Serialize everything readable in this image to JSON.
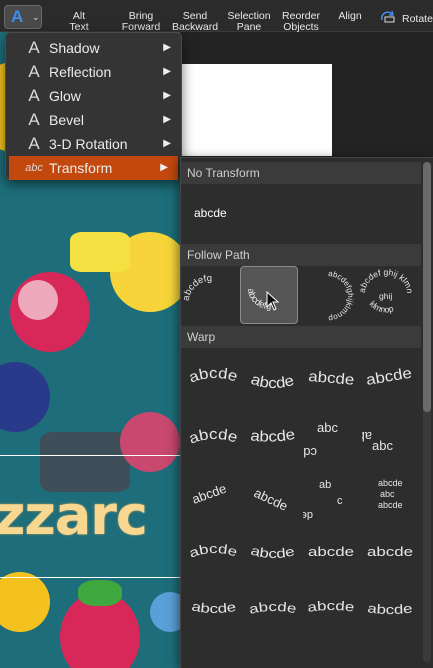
{
  "ribbon": {
    "buttons": [
      {
        "line1": "Alt",
        "line2": "Text",
        "icon": "alt-text-icon"
      },
      {
        "line1": "Bring",
        "line2": "Forward",
        "icon": "bring-forward-icon"
      },
      {
        "line1": "Send",
        "line2": "Backward",
        "icon": "send-backward-icon"
      },
      {
        "line1": "Selection",
        "line2": "Pane",
        "icon": "selection-pane-icon"
      },
      {
        "line1": "Reorder",
        "line2": "Objects",
        "icon": "reorder-objects-icon"
      },
      {
        "line1": "Align",
        "line2": "",
        "icon": "align-icon"
      },
      {
        "line1": "Rotate",
        "line2": "",
        "icon": "rotate-icon"
      }
    ],
    "wordart_glyph": "A",
    "wordart_chevron": "⌄"
  },
  "menu": {
    "items": [
      {
        "label": "Shadow",
        "icon": "text-effect-icon",
        "glyph": "A"
      },
      {
        "label": "Reflection",
        "icon": "text-effect-icon",
        "glyph": "A"
      },
      {
        "label": "Glow",
        "icon": "text-effect-icon",
        "glyph": "A"
      },
      {
        "label": "Bevel",
        "icon": "text-effect-icon",
        "glyph": "A"
      },
      {
        "label": "3-D Rotation",
        "icon": "text-effect-icon",
        "glyph": "A"
      },
      {
        "label": "Transform",
        "icon": "transform-abc-icon",
        "glyph": "abc",
        "active": true
      }
    ],
    "arrow": "▶"
  },
  "submenu": {
    "no_transform_header": "No Transform",
    "no_transform_label": "abcde",
    "follow_path_header": "Follow Path",
    "follow_path_texts": [
      "abcdefg",
      "abcdefg",
      "abcdefghijklmnop",
      "abcdef ghij klmnop"
    ],
    "warp_header": "Warp",
    "warp_label": "abcde",
    "warp_rows": 5,
    "warp_cols": 4
  },
  "colors": {
    "accent": "#c2480e",
    "menu_bg": "#343434",
    "panel_bg": "#2d2d2d",
    "header_bg": "#3b3b3b",
    "wordart_blue": "#3f8fe8"
  },
  "artwork_text": "zzarc"
}
